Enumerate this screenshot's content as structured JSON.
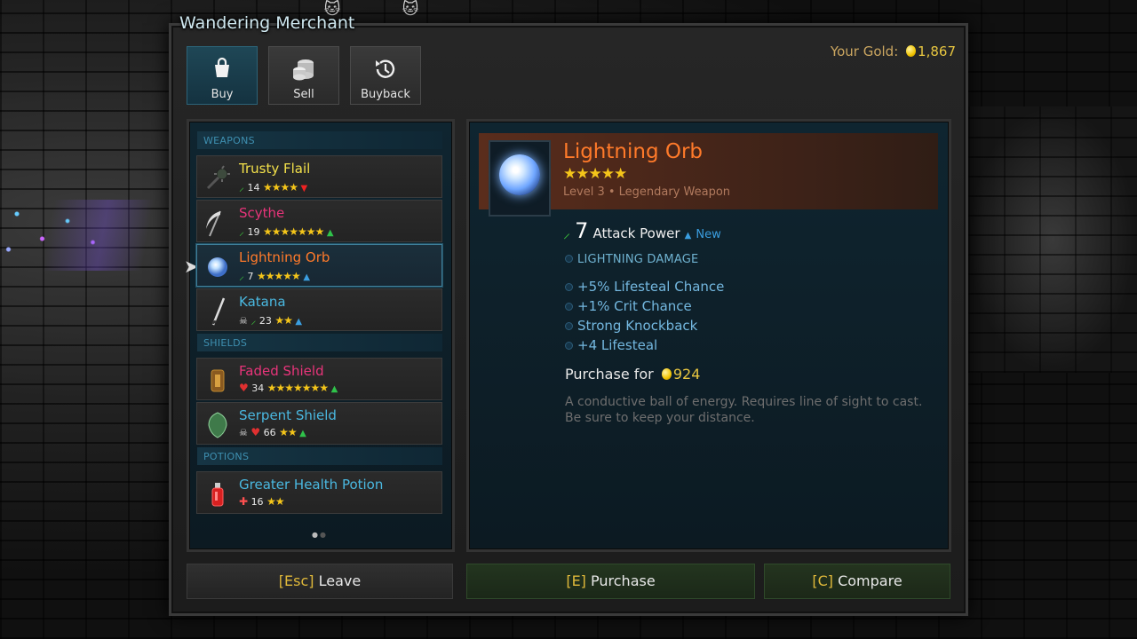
{
  "window": {
    "title": "Wandering Merchant"
  },
  "gold": {
    "label": "Your Gold:",
    "value": "1,867"
  },
  "tabs": [
    {
      "label": "Buy",
      "icon": "shopping-bag-icon",
      "active": true
    },
    {
      "label": "Sell",
      "icon": "coin-stack-icon",
      "active": false
    },
    {
      "label": "Buyback",
      "icon": "history-icon",
      "active": false
    }
  ],
  "sections": {
    "weapons": "WEAPONS",
    "shields": "SHIELDS",
    "potions": "POTIONS"
  },
  "items": [
    {
      "name": "Trusty Flail",
      "color": "#f2e04a",
      "stat": "14",
      "stars": "★★★★",
      "trend": "▼"
    },
    {
      "name": "Scythe",
      "color": "#e8347a",
      "stat": "19",
      "stars": "★★★★★★★",
      "trend": "▲"
    },
    {
      "name": "Lightning Orb",
      "color": "#ff7a2a",
      "stat": "7",
      "stars": "★★★★★",
      "trend": "▲"
    },
    {
      "name": "Katana",
      "color": "#4ab8e0",
      "stat": "23",
      "stars": "★★",
      "trend": "▲"
    },
    {
      "name": "Faded Shield",
      "color": "#e8347a",
      "stat": "34",
      "stars": "★★★★★★★",
      "trend": "▲"
    },
    {
      "name": "Serpent Shield",
      "color": "#4ab8e0",
      "stat": "66",
      "stars": "★★",
      "trend": "▲"
    },
    {
      "name": "Greater Health Potion",
      "color": "#4ab8e0",
      "stat": "16",
      "stars": "★★",
      "trend": ""
    }
  ],
  "detail": {
    "name": "Lightning Orb",
    "stars": "★★★★★",
    "subtitle": "Level 3 • Legendary Weapon",
    "attack_value": "7",
    "attack_label": "Attack Power",
    "new_label": "New",
    "damage_type": "LIGHTNING DAMAGE",
    "bonuses": [
      "+5% Lifesteal Chance",
      "+1% Crit Chance",
      "Strong Knockback",
      "+4 Lifesteal"
    ],
    "purchase_label": "Purchase for",
    "price": "924",
    "description": "A conductive ball of energy. Requires line of sight to cast. Be sure to keep your distance."
  },
  "buttons": {
    "leave_key": "[Esc]",
    "leave_label": "Leave",
    "purchase_key": "[E]",
    "purchase_label": "Purchase",
    "compare_key": "[C]",
    "compare_label": "Compare"
  },
  "colors": {
    "gold": "#e7c640",
    "legendary": "#ff7a2a",
    "accent_blue": "#4ab8e0"
  }
}
